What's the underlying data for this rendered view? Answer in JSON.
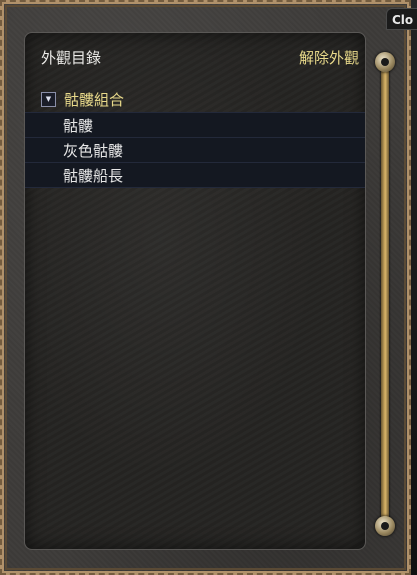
{
  "panel": {
    "title": "外觀目錄",
    "unequip_label": "解除外觀"
  },
  "list": {
    "group": {
      "label": "骷髏組合",
      "toggle_symbol": "▼",
      "expanded": true
    },
    "items": [
      {
        "label": "骷髏"
      },
      {
        "label": "灰色骷髏"
      },
      {
        "label": "骷髏船長"
      }
    ]
  },
  "close_tab": {
    "label": "Clo"
  },
  "colors": {
    "group_text": "#e8d98a",
    "item_text": "#e6e6e6",
    "row_bg": "#141821",
    "frame": "#b0916a"
  }
}
